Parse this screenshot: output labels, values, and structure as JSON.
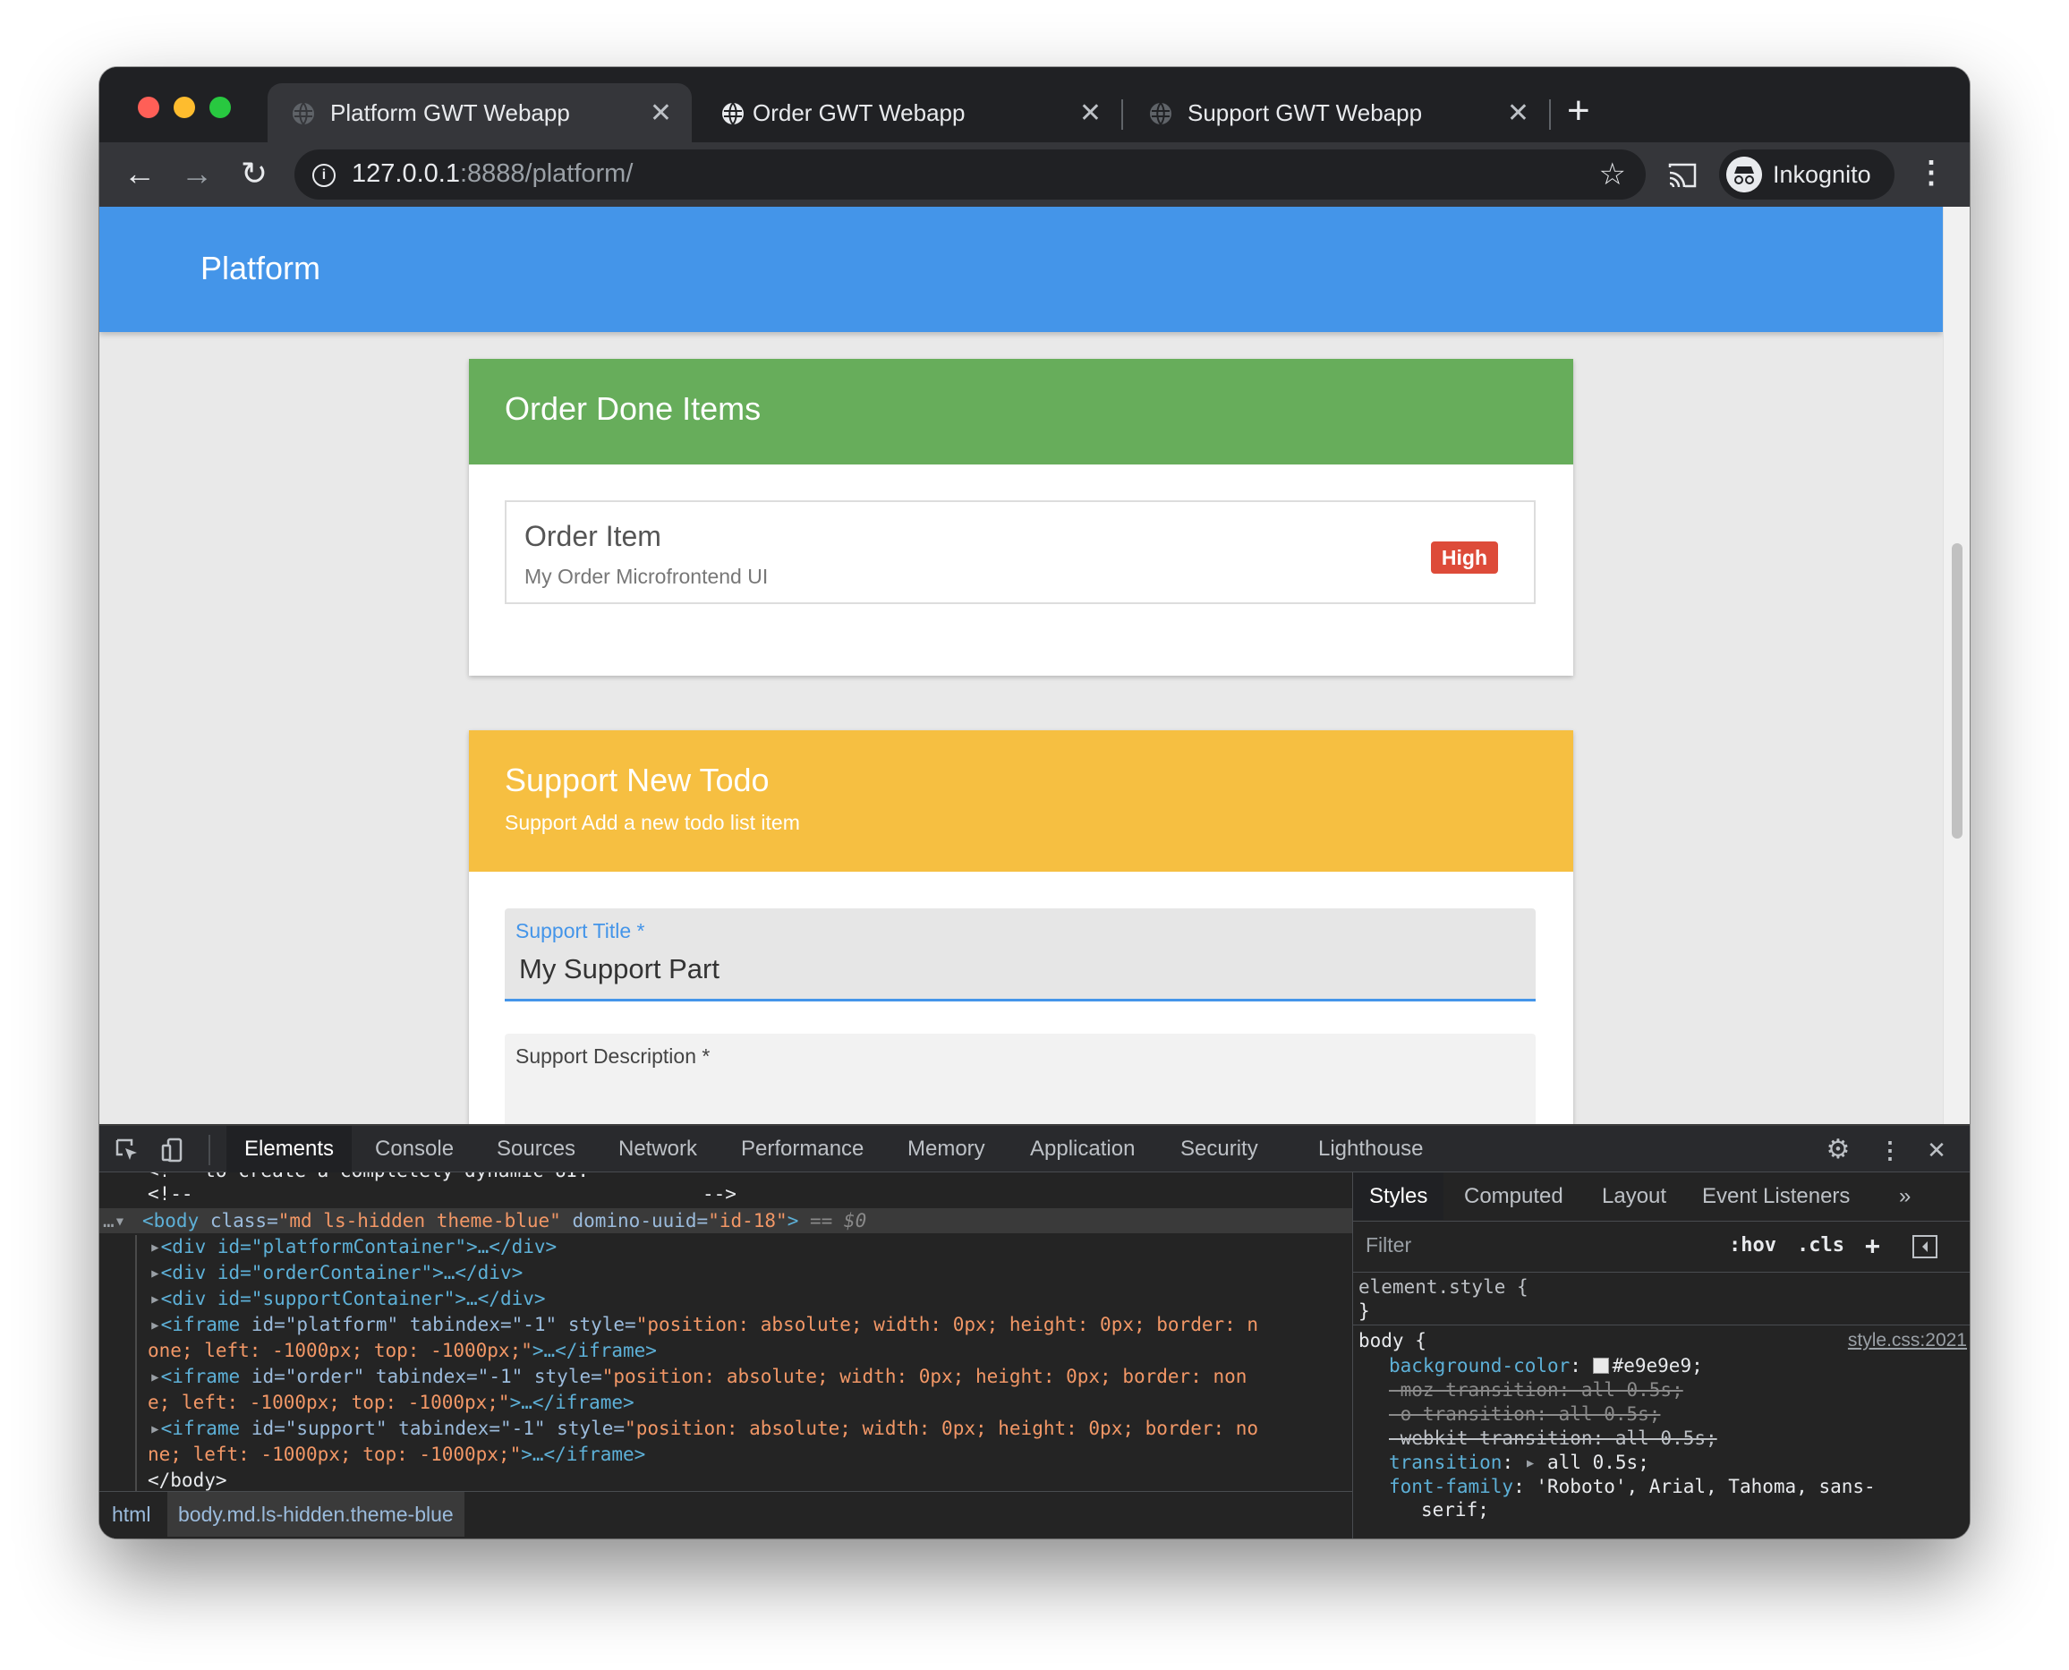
{
  "browser": {
    "tabs": [
      {
        "title": "Platform GWT Webapp",
        "active": true
      },
      {
        "title": "Order GWT Webapp",
        "active": false
      },
      {
        "title": "Support GWT Webapp",
        "active": false
      }
    ],
    "new_tab": "+",
    "url_host": "127.0.0.1",
    "url_path": ":8888/platform/",
    "profile_name": "Inkognito"
  },
  "app": {
    "title": "Platform",
    "colors": {
      "appbar": "#4495e9",
      "order_header": "#67ad5b",
      "support_header": "#f6bf41",
      "badge": "#dd4b39",
      "page_bg": "#e9e9e9"
    }
  },
  "order_card": {
    "title": "Order Done Items",
    "item": {
      "title": "Order Item",
      "description": "My Order Microfrontend UI",
      "priority": "High"
    }
  },
  "support_card": {
    "title": "Support New Todo",
    "subtitle": "Support Add a new todo list item",
    "fields": {
      "title_label": "Support Title *",
      "title_value": "My Support Part",
      "description_label": "Support Description *"
    }
  },
  "devtools": {
    "tabs": [
      "Elements",
      "Console",
      "Sources",
      "Network",
      "Performance",
      "Memory",
      "Application",
      "Security",
      "Lighthouse"
    ],
    "dom_lines": {
      "l0": "<!-- to create a completely dynamic UI.",
      "l1": "<!--",
      "l1b": "-->",
      "body_open": "<body",
      "body_class_attr": " class=",
      "body_class_val": "\"md ls-hidden theme-blue\"",
      "body_uuid_attr": " domino-uuid=",
      "body_uuid_val": "\"id-18\"",
      "body_close": ">",
      "body_marker": " == $0",
      "div1": "<div id=\"platformContainer\">…</div>",
      "div2": "<div id=\"orderContainer\">…</div>",
      "div3": "<div id=\"supportContainer\">…</div>",
      "if1_tag": "<iframe",
      "if1_attrs": " id=\"platform\" tabindex=\"-1\" style=",
      "if1_style": "\"position: absolute; width: 0px; height: 0px; border: n",
      "if1_cont": "one; left: -1000px; top: -1000px;\"",
      "if1_end": ">…</iframe>",
      "if2_attrs": " id=\"order\" tabindex=\"-1\" style=",
      "if2_style": "\"position: absolute; width: 0px; height: 0px; border: non",
      "if2_cont": "e; left: -1000px; top: -1000px;\"",
      "if3_attrs": " id=\"support\" tabindex=\"-1\" style=",
      "if3_style": "\"position: absolute; width: 0px; height: 0px; border: no",
      "if3_cont": "ne; left: -1000px; top: -1000px;\"",
      "body_end": "</body>"
    },
    "breadcrumbs": [
      "html",
      "body.md.ls-hidden.theme-blue"
    ],
    "styles_tabs": [
      "Styles",
      "Computed",
      "Layout",
      "Event Listeners",
      "»"
    ],
    "filter_placeholder": "Filter",
    "filter_tokens": [
      ":hov",
      ".cls",
      "+"
    ],
    "rules": {
      "element_style": "element.style {",
      "close": "}",
      "body_selector": "body {",
      "source": "style.css:2021",
      "bg_prop": "background-color",
      "bg_val": "#e9e9e9;",
      "moz": "-moz-transition: all 0.5s;",
      "o": "-o-transition: all 0.5s;",
      "webkit": "-webkit-transition: all 0.5s;",
      "transition_prop": "transition",
      "transition_val": "all 0.5s;",
      "font_prop": "font-family",
      "font_val": "'Roboto', Arial, Tahoma, sans-",
      "font_val2": "serif;"
    }
  }
}
